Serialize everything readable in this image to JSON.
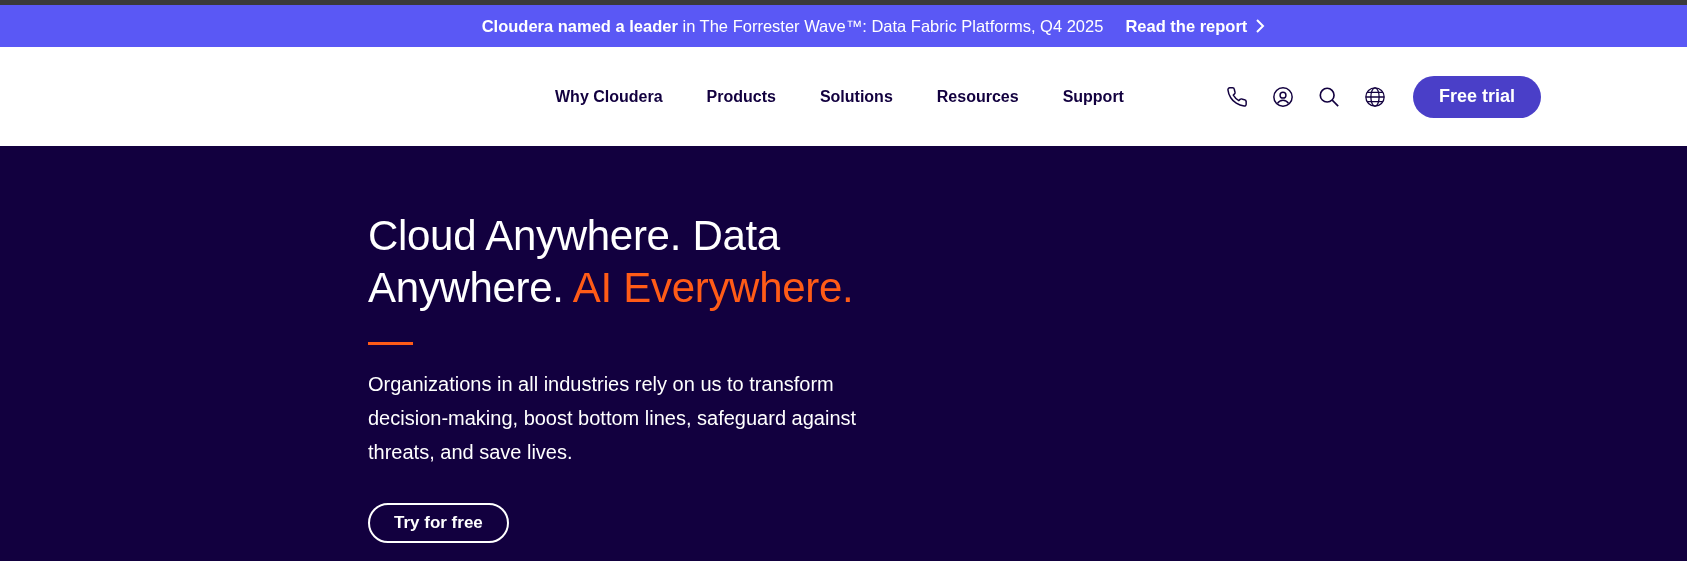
{
  "announcement": {
    "text": "**Cloudera named a leader** in The Forrester Wave™: Data Fabric Platforms, Q4 2025",
    "link": "Read the report"
  },
  "nav": {
    "items": [
      {
        "label": "Why Cloudera"
      },
      {
        "label": "Products"
      },
      {
        "label": "Solutions"
      },
      {
        "label": "Resources"
      },
      {
        "label": "Support"
      }
    ],
    "cta": "Free trial"
  },
  "hero": {
    "headline": "Cloud Anywhere. Data Anywhere.",
    "headline_highlight": "AI Everywhere.",
    "body": "Organizations in all industries rely on us to transform decision-making, boost bottom lines, safeguard against threats, and save lives.",
    "button": "Try for free"
  }
}
